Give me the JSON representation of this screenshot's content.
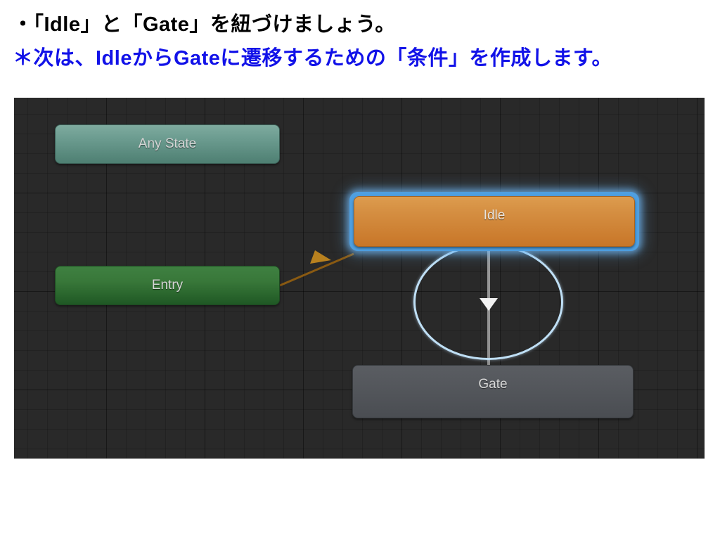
{
  "slide": {
    "lines": [
      {
        "id": "line-1",
        "text": "・「Idle」と「Gate」を紐づけましょう。",
        "color": "#000000"
      },
      {
        "id": "line-2",
        "text": "＊次は、IdleからGateに遷移するための「条件」を作成します。",
        "color": "#1212e8"
      }
    ]
  },
  "animator": {
    "canvas": {
      "background_color": "#292929",
      "grid_line_color": "#1e1e1e"
    },
    "nodes": [
      {
        "id": "any-state",
        "label": "Any State",
        "color": "#6c9c90",
        "selected": false
      },
      {
        "id": "entry",
        "label": "Entry",
        "color": "#387739",
        "selected": false
      },
      {
        "id": "idle",
        "label": "Idle",
        "color": "#d58f42",
        "selected": true,
        "selection_color": "#4f9fe0"
      },
      {
        "id": "gate",
        "label": "Gate",
        "color": "#54575c",
        "selected": false
      }
    ],
    "transitions": [
      {
        "id": "entry-to-idle",
        "from": "entry",
        "to": "idle",
        "color": "#8a5a12",
        "selected": false
      },
      {
        "id": "idle-to-gate",
        "from": "idle",
        "to": "gate",
        "color": "#9a9a9a",
        "selected": true,
        "selection_color": "#bfdff5"
      }
    ]
  }
}
